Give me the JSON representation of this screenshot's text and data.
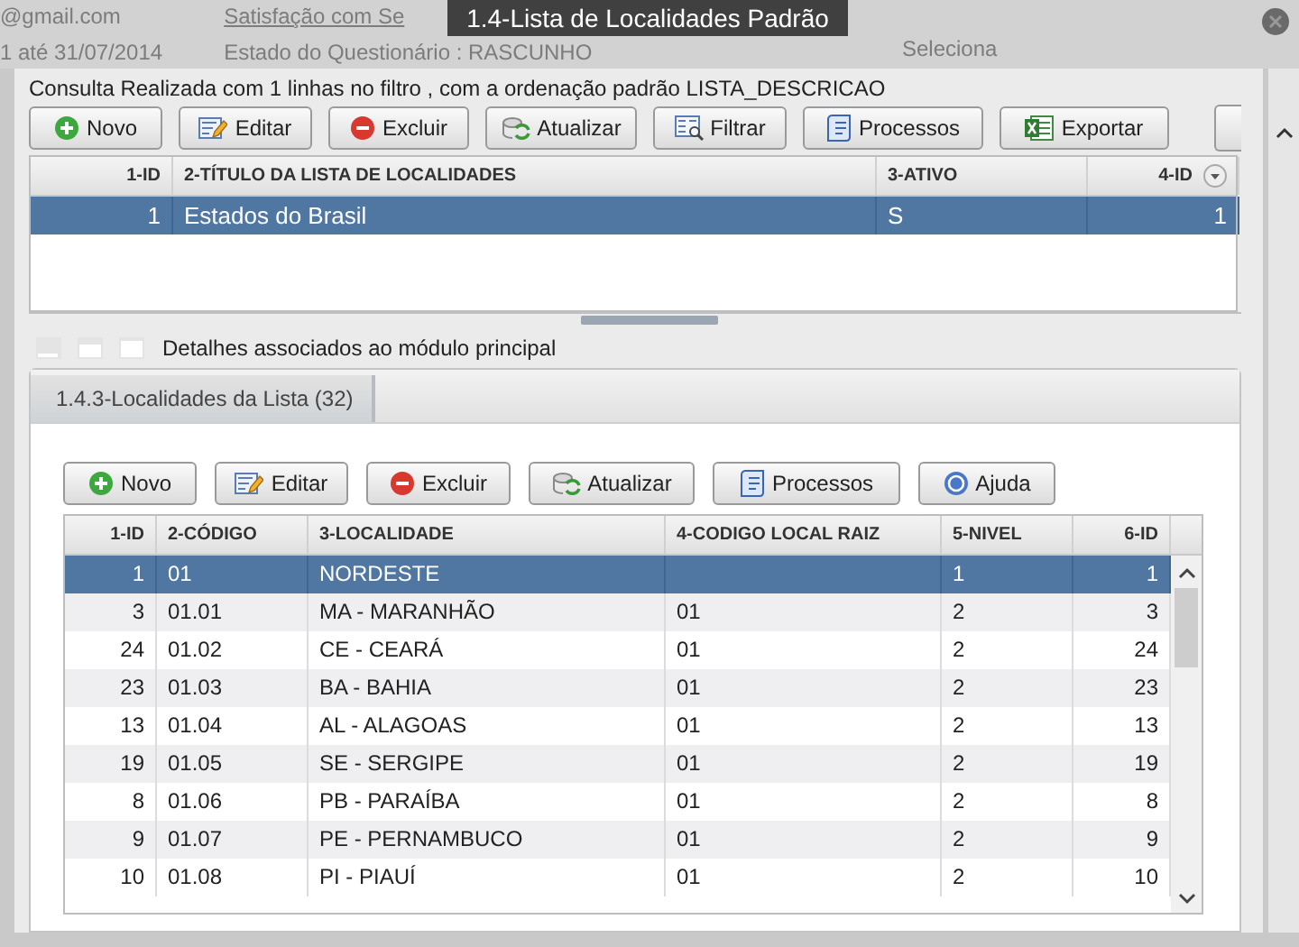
{
  "backdrop": {
    "texts": [
      "@gmail.com",
      "1 até 31/07/2014",
      "Satisfação com Se",
      "Estado do Questionário : RASCUNHO",
      "Seleciona"
    ]
  },
  "window": {
    "title": "1.4-Lista de Localidades Padrão"
  },
  "query_info": "Consulta Realizada com 1 linhas no filtro , com a ordenação padrão LISTA_DESCRICAO",
  "toolbar": [
    "Novo",
    "Editar",
    "Excluir",
    "Atualizar",
    "Filtrar",
    "Processos",
    "Exportar"
  ],
  "master_table": {
    "columns": [
      "1-ID",
      "2-TÍTULO DA LISTA DE LOCALIDADES",
      "3-ATIVO",
      "4-ID"
    ],
    "rows": [
      {
        "cells": [
          "1",
          "Estados do Brasil",
          "S",
          "1"
        ],
        "selected": true
      }
    ]
  },
  "details": {
    "label": "Detalhes associados ao módulo principal",
    "tabs": [
      {
        "label": "1.4.3-Localidades da Lista (32)",
        "selected": true
      }
    ],
    "toolbar": [
      "Novo",
      "Editar",
      "Excluir",
      "Atualizar",
      "Processos",
      "Ajuda"
    ],
    "table": {
      "columns": [
        "1-ID",
        "2-CÓDIGO",
        "3-LOCALIDADE",
        "4-CODIGO LOCAL RAIZ",
        "5-NIVEL",
        "6-ID"
      ],
      "rows": [
        {
          "cells": [
            "1",
            "01",
            "NORDESTE",
            "",
            "1",
            "1"
          ],
          "selected": true
        },
        {
          "cells": [
            "3",
            "01.01",
            "MA - MARANHÃO",
            "01",
            "2",
            "3"
          ],
          "selected": false
        },
        {
          "cells": [
            "24",
            "01.02",
            "CE - CEARÁ",
            "01",
            "2",
            "24"
          ],
          "selected": false
        },
        {
          "cells": [
            "23",
            "01.03",
            "BA - BAHIA",
            "01",
            "2",
            "23"
          ],
          "selected": false
        },
        {
          "cells": [
            "13",
            "01.04",
            "AL - ALAGOAS",
            "01",
            "2",
            "13"
          ],
          "selected": false
        },
        {
          "cells": [
            "19",
            "01.05",
            "SE - SERGIPE",
            "01",
            "2",
            "19"
          ],
          "selected": false
        },
        {
          "cells": [
            "8",
            "01.06",
            "PB - PARAÍBA",
            "01",
            "2",
            "8"
          ],
          "selected": false
        },
        {
          "cells": [
            "9",
            "01.07",
            "PE - PERNAMBUCO",
            "01",
            "2",
            "9"
          ],
          "selected": false
        },
        {
          "cells": [
            "10",
            "01.08",
            "PI - PIAUÍ",
            "01",
            "2",
            "10"
          ],
          "selected": false
        }
      ]
    }
  }
}
